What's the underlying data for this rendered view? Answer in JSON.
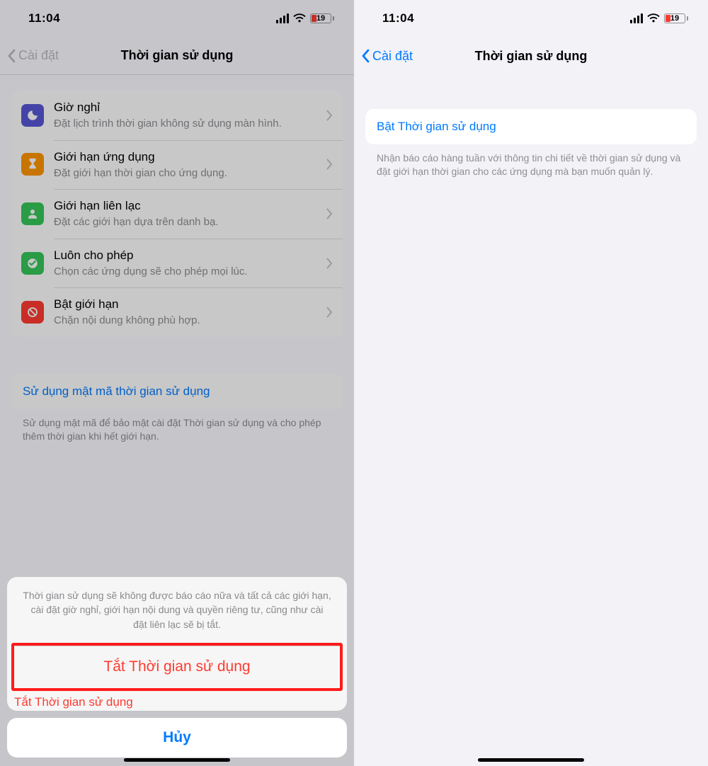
{
  "status": {
    "time": "11:04",
    "battery_pct": "19"
  },
  "nav": {
    "back": "Cài đặt",
    "title": "Thời gian sử dụng"
  },
  "left": {
    "rows": [
      {
        "icon_bg": "#5856d6",
        "title": "Giờ nghỉ",
        "sub": "Đặt lịch trình thời gian không sử dụng màn hình."
      },
      {
        "icon_bg": "#ff9500",
        "title": "Giới hạn ứng dụng",
        "sub": "Đặt giới hạn thời gian cho ứng dụng."
      },
      {
        "icon_bg": "#34c759",
        "title": "Giới hạn liên lạc",
        "sub": "Đặt các giới hạn dựa trên danh bạ."
      },
      {
        "icon_bg": "#34c759",
        "title": "Luôn cho phép",
        "sub": "Chọn các ứng dụng sẽ cho phép mọi lúc."
      },
      {
        "icon_bg": "#ff3b30",
        "title": "Bật giới hạn",
        "sub": "Chặn nội dung không phù hợp."
      }
    ],
    "passcode_link": "Sử dụng mật mã thời gian sử dụng",
    "passcode_footer": "Sử dụng mật mã để bảo mật cài đặt Thời gian sử dụng và cho phép thêm thời gian khi hết giới hạn.",
    "sheet_msg": "Thời gian sử dụng sẽ không được báo cáo nữa và tất cả các giới hạn, cài đặt giờ nghỉ, giới hạn nội dung và quyền riêng tư, cũng như cài đặt liên lạc sẽ bị tắt.",
    "sheet_action": "Tắt Thời gian sử dụng",
    "sheet_behind": "Tắt Thời gian sử dụng",
    "sheet_cancel": "Hủy"
  },
  "right": {
    "enable_link": "Bật Thời gian sử dụng",
    "enable_footer": "Nhận báo cáo hàng tuần với thông tin chi tiết về thời gian sử dụng và đặt giới hạn thời gian cho các ứng dụng mà bạn muốn quản lý."
  }
}
